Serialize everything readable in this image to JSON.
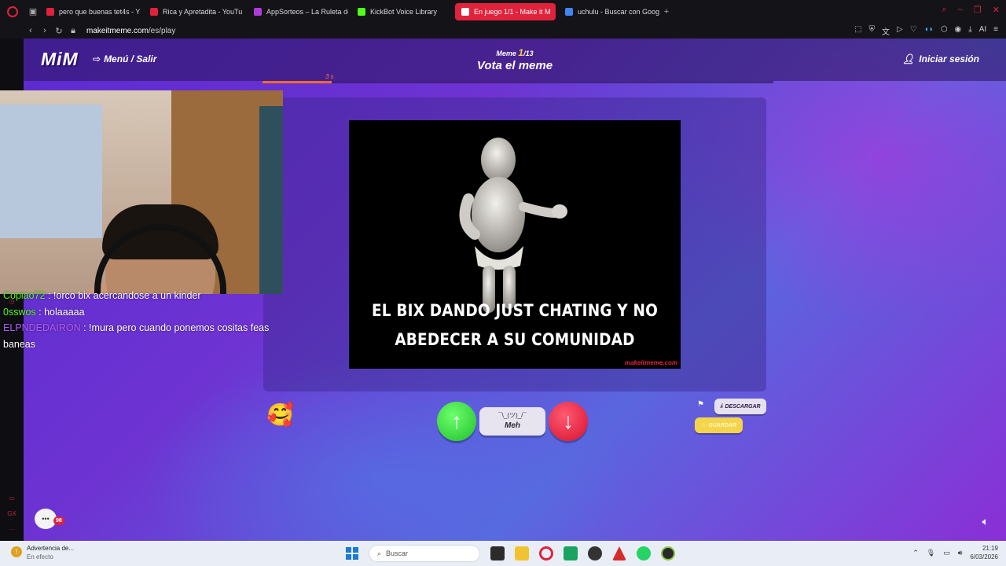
{
  "browser": {
    "tabs": [
      {
        "title": "pero que buenas tet4s - Y",
        "color": "#e0223c"
      },
      {
        "title": "Rica y Apretadita - YouTu",
        "color": "#e0223c"
      },
      {
        "title": "AppSorteos – La Ruleta de",
        "color": "#b03ad8"
      },
      {
        "title": "KickBot Voice Library",
        "color": "#53fc18"
      },
      {
        "title": "En juego 1/1 - Make it M",
        "color": "#ffffff",
        "active": true
      },
      {
        "title": "uchulu - Buscar con Goog",
        "color": "#4285f4"
      }
    ],
    "url_host": "makeitmeme.com",
    "url_path": "/es/play",
    "ai_label": "AI"
  },
  "site": {
    "logo": "MiM",
    "menu_label": "Menú / Salir",
    "round_label": "Meme",
    "round_current": "1",
    "round_total": "/13",
    "title": "Vota el meme",
    "login_label": "Iniciar sesión",
    "timer_text": "3 s",
    "timer_progress": 0.135
  },
  "meme": {
    "caption_line1": "EL BIX DANDO JUST CHATING Y NO",
    "caption_line2": "ABEDECER A SU COMUNIDAD",
    "watermark": "makeitmeme.com"
  },
  "vote": {
    "up_icon": "arrow-up-icon",
    "meh_face": "¯\\_(ツ)_/¯",
    "meh_label": "Meh",
    "down_icon": "arrow-down-icon",
    "download_label": "DESCARGAR",
    "save_label": "GUARDAR"
  },
  "chat_widget": {
    "badge": "98"
  },
  "stream_chat": [
    {
      "user": "Copiao72",
      "user_color": "#53fc18",
      "message": " : !orco bix acercandose a un kinder"
    },
    {
      "user": "0sswos",
      "user_color": "#53fc18",
      "message": " : holaaaaa"
    },
    {
      "user": "ELPNDEDAIRON",
      "user_color": "#b05cff",
      "message": " : !mura pero cuando ponemos cositas feas baneas"
    }
  ],
  "taskbar": {
    "notice_title": "Advertencia de...",
    "notice_sub": "En efecto",
    "search_placeholder": "Buscar",
    "time": "21:19",
    "date": "6/03/2026"
  }
}
